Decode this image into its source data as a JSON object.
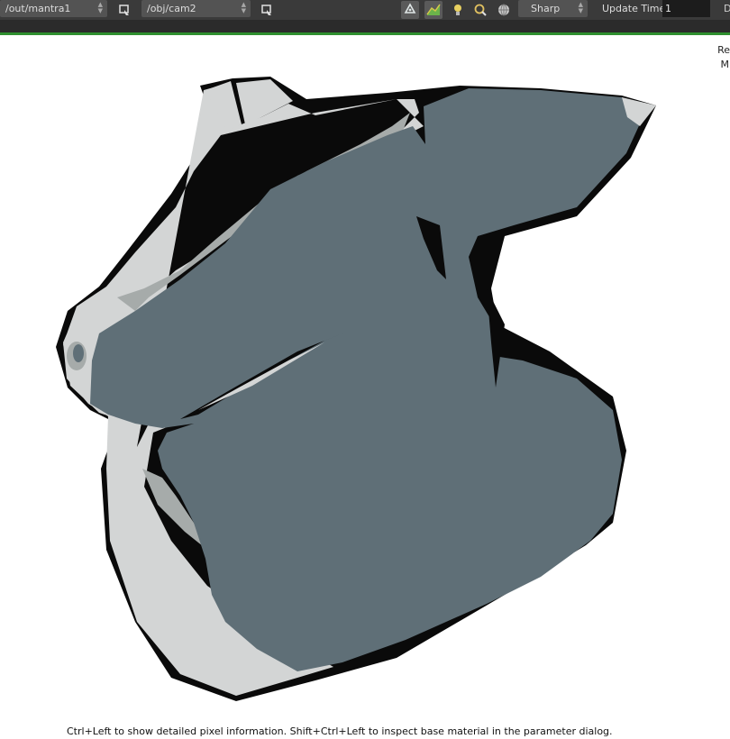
{
  "toolbar": {
    "output_driver": "/out/mantra1",
    "camera": "/obj/cam2",
    "filter_mode": "Sharp",
    "update_time_label": "Update Time",
    "update_time_value": "1",
    "right_clip": "D"
  },
  "side_panel": {
    "line1": "Re",
    "line2": "M"
  },
  "status": {
    "hint": "Ctrl+Left to show detailed pixel information. Shift+Ctrl+Left to inspect base material in the parameter dialog."
  },
  "colors": {
    "toolbar_bg": "#3a3a3a",
    "accent_green": "#2f8f2f",
    "mesh_dark": "#5f6f77",
    "mesh_light": "#d3d5d5",
    "mesh_mid": "#a6abaa",
    "outline": "#0a0a0a"
  },
  "icons": [
    "pin-icon",
    "pin-icon",
    "recycle-icon",
    "map-icon",
    "light-bulb-icon",
    "magnifier-icon",
    "sphere-icon"
  ]
}
